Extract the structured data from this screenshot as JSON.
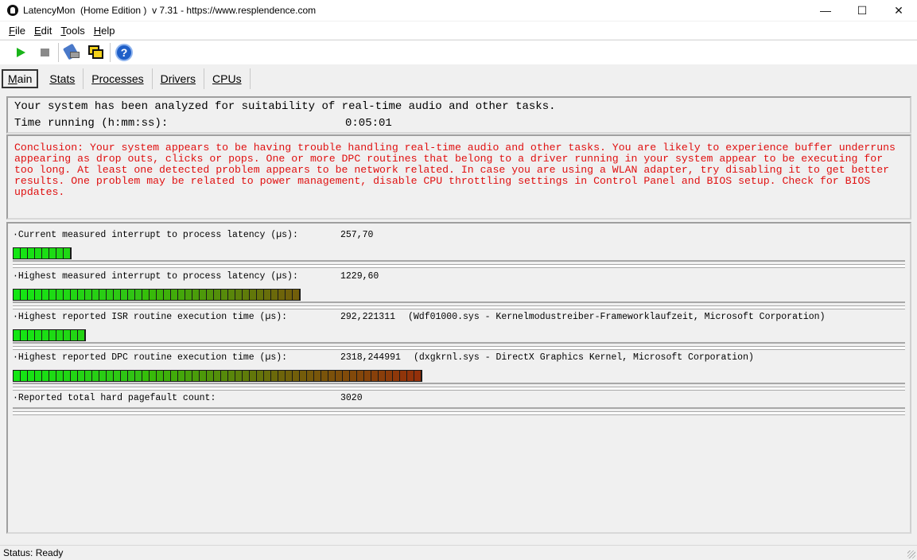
{
  "window": {
    "title": "LatencyMon  (Home Edition )  v 7.31 - https://www.resplendence.com",
    "minimize": "—",
    "maximize": "☐",
    "close": "✕"
  },
  "menu": [
    "File",
    "Edit",
    "Tools",
    "Help"
  ],
  "toolbar": {
    "start_icon": "play-icon",
    "stop_icon": "stop-icon",
    "tools_icon": "tools-icon",
    "windows_icon": "windows-icon",
    "help_icon": "help-icon",
    "help_glyph": "?"
  },
  "tabs": [
    "Main",
    "Stats",
    "Processes",
    "Drivers",
    "CPUs"
  ],
  "summary": {
    "analyzed": "Your system has been analyzed for suitability of real-time audio and other tasks.",
    "time_label": "Time running (h:mm:ss):",
    "time_value": "0:05:01"
  },
  "conclusion": "Conclusion: Your system appears to be having trouble handling real-time audio and other tasks. You are likely to experience buffer underruns appearing as drop outs, clicks or pops. One or more DPC routines that belong to a driver running in your system appear to be executing for too long. At least one detected problem appears to be network related. In case you are using a WLAN adapter, try disabling it to get better results. One problem may be related to power management, disable CPU throttling settings in Control Panel and BIOS setup. Check for BIOS updates.",
  "metrics": [
    {
      "label": "·Current measured interrupt to process latency (µs):",
      "value": "257,70",
      "extra": "",
      "segments": 8
    },
    {
      "label": "·Highest measured interrupt to process latency (µs):",
      "value": "1229,60",
      "extra": "",
      "segments": 40
    },
    {
      "label": "·Highest reported ISR routine execution time (µs):",
      "value": "292,221311",
      "extra": "(Wdf01000.sys - Kernelmodustreiber-Frameworklaufzeit, Microsoft Corporation)",
      "segments": 10
    },
    {
      "label": "·Highest reported DPC routine execution time (µs):",
      "value": "2318,244991",
      "extra": "(dxgkrnl.sys - DirectX Graphics Kernel, Microsoft Corporation)",
      "segments": 57
    },
    {
      "label": "·Reported total hard pagefault count:",
      "value": "3020",
      "extra": "",
      "segments": 0
    }
  ],
  "status": "Status: Ready"
}
